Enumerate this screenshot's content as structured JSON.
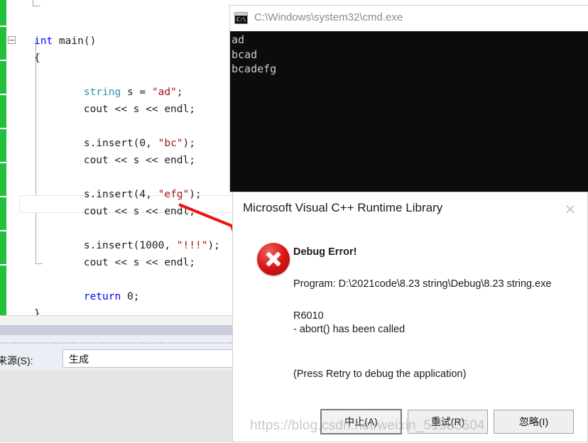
{
  "editor": {
    "code_lines": [
      {
        "indent": 0,
        "tokens": [
          {
            "t": "int ",
            "c": "kw"
          },
          {
            "t": "main()",
            "c": "plain"
          }
        ]
      },
      {
        "indent": 0,
        "tokens": [
          {
            "t": "{",
            "c": "plain"
          }
        ]
      },
      {
        "indent": 0,
        "tokens": [
          {
            "t": "",
            "c": "plain"
          }
        ]
      },
      {
        "indent": 1,
        "tokens": [
          {
            "t": "string",
            "c": "type"
          },
          {
            "t": " s = ",
            "c": "plain"
          },
          {
            "t": "\"ad\"",
            "c": "str"
          },
          {
            "t": ";",
            "c": "plain"
          }
        ]
      },
      {
        "indent": 1,
        "tokens": [
          {
            "t": "cout << s << endl;",
            "c": "plain"
          }
        ]
      },
      {
        "indent": 0,
        "tokens": [
          {
            "t": "",
            "c": "plain"
          }
        ]
      },
      {
        "indent": 1,
        "tokens": [
          {
            "t": "s.insert(0, ",
            "c": "plain"
          },
          {
            "t": "\"bc\"",
            "c": "str"
          },
          {
            "t": ");",
            "c": "plain"
          }
        ]
      },
      {
        "indent": 1,
        "tokens": [
          {
            "t": "cout << s << endl;",
            "c": "plain"
          }
        ]
      },
      {
        "indent": 0,
        "tokens": [
          {
            "t": "",
            "c": "plain"
          }
        ]
      },
      {
        "indent": 1,
        "tokens": [
          {
            "t": "s.insert(4, ",
            "c": "plain"
          },
          {
            "t": "\"efg\"",
            "c": "str"
          },
          {
            "t": ");",
            "c": "plain"
          }
        ]
      },
      {
        "indent": 1,
        "tokens": [
          {
            "t": "cout << s << endl;",
            "c": "plain"
          }
        ]
      },
      {
        "indent": 0,
        "tokens": [
          {
            "t": "",
            "c": "plain"
          }
        ]
      },
      {
        "indent": 1,
        "tokens": [
          {
            "t": "s.insert(1000, ",
            "c": "plain"
          },
          {
            "t": "\"!!!\"",
            "c": "str"
          },
          {
            "t": ");",
            "c": "plain"
          }
        ]
      },
      {
        "indent": 1,
        "tokens": [
          {
            "t": "cout << s << endl;",
            "c": "plain"
          }
        ]
      },
      {
        "indent": 0,
        "tokens": [
          {
            "t": "",
            "c": "plain"
          }
        ]
      },
      {
        "indent": 1,
        "tokens": [
          {
            "t": "return",
            "c": "kw"
          },
          {
            "t": " 0;",
            "c": "plain"
          }
        ]
      },
      {
        "indent": 0,
        "tokens": [
          {
            "t": "}",
            "c": "plain"
          }
        ]
      }
    ],
    "change_bar_color": "#22c03c",
    "keyword_color": "#0000ff",
    "type_color": "#2b91af",
    "string_color": "#a31515"
  },
  "output_panel": {
    "source_label": "来源(S):",
    "source_value": "生成"
  },
  "cmd_window": {
    "title": "C:\\Windows\\system32\\cmd.exe",
    "icon": "cmd-console-icon",
    "console_lines": [
      "ad",
      "bcad",
      "bcadefg"
    ],
    "background": "#0c0c0c",
    "foreground": "#cccccc"
  },
  "dialog": {
    "title": "Microsoft Visual C++ Runtime Library",
    "close_glyph": "✕",
    "icon": "error-circle-icon",
    "heading": "Debug Error!",
    "program_line": "Program: D:\\2021code\\8.23 string\\Debug\\8.23 string.exe",
    "error_code": "R6010",
    "error_detail": "- abort() has been called",
    "hint": "(Press Retry to debug the application)",
    "buttons": [
      {
        "label": "中止(A)",
        "name": "abort-button",
        "primary": true
      },
      {
        "label": "重试(R)",
        "name": "retry-button",
        "primary": false
      },
      {
        "label": "忽略(I)",
        "name": "ignore-button",
        "primary": false
      }
    ]
  },
  "annotation": {
    "arrow_color": "#ee1111"
  },
  "watermark": {
    "text": "https://blog.csdn.net/weixin_51983604"
  }
}
